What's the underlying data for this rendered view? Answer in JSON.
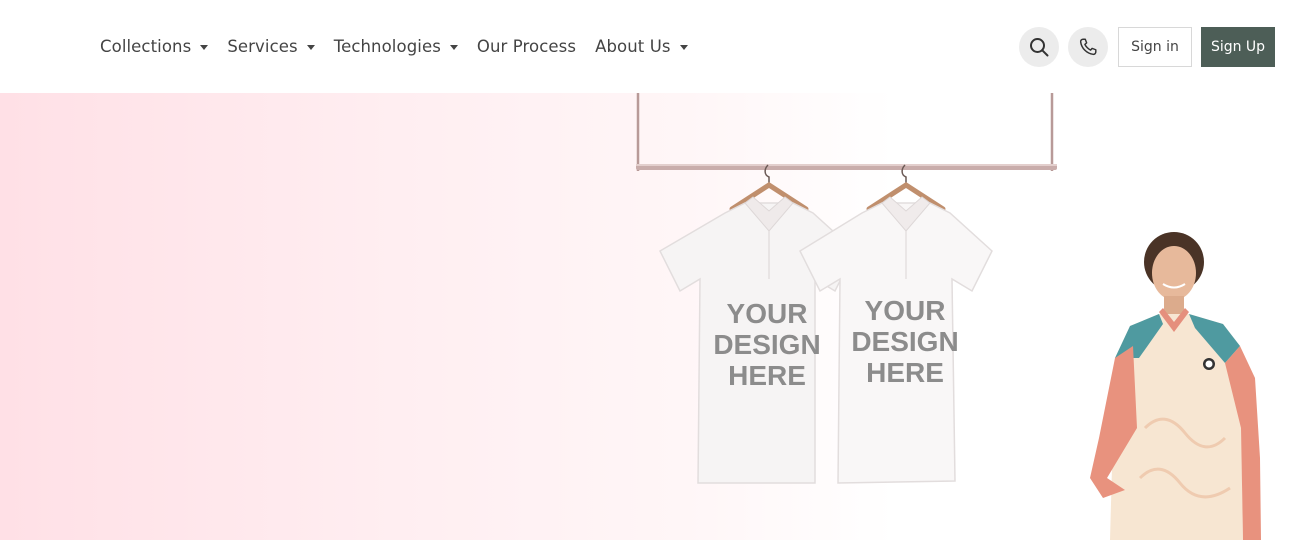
{
  "nav": {
    "items": [
      {
        "label": "Collections",
        "has_dropdown": true
      },
      {
        "label": "Services",
        "has_dropdown": true
      },
      {
        "label": "Technologies",
        "has_dropdown": true
      },
      {
        "label": "Our Process",
        "has_dropdown": false
      },
      {
        "label": "About Us",
        "has_dropdown": true
      }
    ]
  },
  "actions": {
    "search_icon": "search-icon",
    "phone_icon": "phone-icon",
    "sign_in_label": "Sign in",
    "sign_up_label": "Sign Up"
  },
  "hero": {
    "shirt_left_text": [
      "YOUR",
      "DESIGN",
      "HERE"
    ],
    "shirt_right_text": [
      "YOUR",
      "DESIGN",
      "HERE"
    ]
  },
  "colors": {
    "accent": "#4d5e57",
    "hero_gradient_start": "#ffe0e6",
    "icon_bg": "#ececec"
  }
}
